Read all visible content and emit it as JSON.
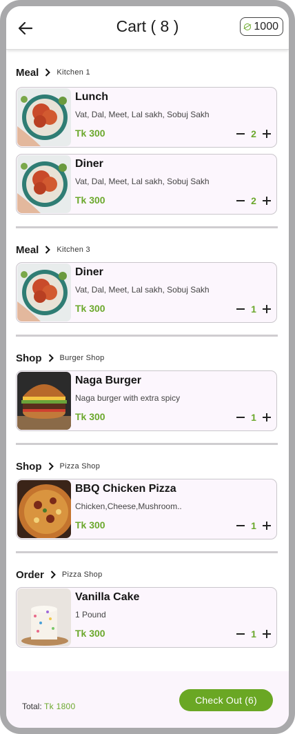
{
  "header": {
    "title": "Cart ( 8 )",
    "coins": "1000",
    "back_icon": "arrow-left-icon",
    "coin_icon": "coin-icon"
  },
  "sections": [
    {
      "title": "Meal",
      "subtitle": "Kitchen 1",
      "items": [
        {
          "name": "Lunch",
          "desc": "Vat, Dal, Meet, Lal sakh, Sobuj Sakh",
          "price": "Tk 300",
          "qty": "2",
          "image": "food-bowl"
        },
        {
          "name": "Diner",
          "desc": "Vat, Dal, Meet, Lal sakh, Sobuj Sakh",
          "price": "Tk 300",
          "qty": "2",
          "image": "food-bowl"
        }
      ]
    },
    {
      "title": "Meal",
      "subtitle": "Kitchen 3",
      "items": [
        {
          "name": "Diner",
          "desc": "Vat, Dal, Meet, Lal sakh, Sobuj Sakh",
          "price": "Tk 300",
          "qty": "1",
          "image": "food-bowl"
        }
      ]
    },
    {
      "title": "Shop",
      "subtitle": "Burger Shop",
      "items": [
        {
          "name": "Naga Burger",
          "desc": "Naga burger with extra spicy",
          "price": "Tk 300",
          "qty": "1",
          "image": "burger"
        }
      ]
    },
    {
      "title": "Shop",
      "subtitle": "Pizza Shop",
      "items": [
        {
          "name": "BBQ Chicken Pizza",
          "desc": "Chicken,Cheese,Mushroom..",
          "price": "Tk 300",
          "qty": "1",
          "image": "pizza"
        }
      ]
    },
    {
      "title": "Order",
      "subtitle": "Pizza Shop",
      "items": [
        {
          "name": "Vanilla Cake",
          "desc": "1 Pound",
          "price": "Tk 300",
          "qty": "1",
          "image": "cake"
        }
      ]
    }
  ],
  "footer": {
    "total_label": "Total:",
    "total_value": "Tk 1800",
    "checkout_label": "Check Out (6)"
  },
  "colors": {
    "accent": "#6ba82c",
    "card_bg": "#fcf6fd",
    "frame": "#a9a9ab"
  }
}
